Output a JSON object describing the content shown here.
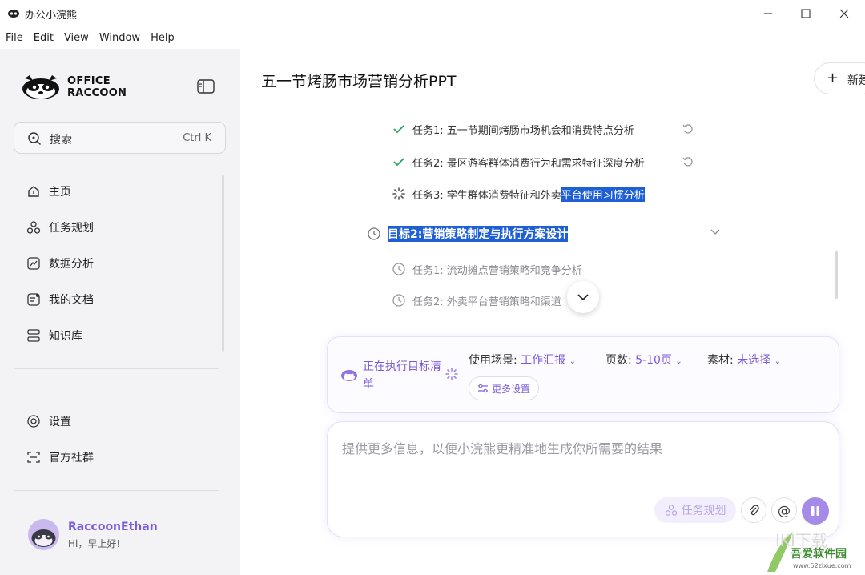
{
  "window": {
    "title": "办公小浣熊"
  },
  "menu": [
    "File",
    "Edit",
    "View",
    "Window",
    "Help"
  ],
  "sidebar": {
    "logo_line1": "OFFICE",
    "logo_line2": "RACCOON",
    "search": {
      "label": "搜索",
      "shortcut": "Ctrl K"
    },
    "nav": [
      {
        "label": "主页",
        "icon": "home-icon"
      },
      {
        "label": "任务规划",
        "icon": "task-plan-icon"
      },
      {
        "label": "数据分析",
        "icon": "data-analysis-icon"
      },
      {
        "label": "我的文档",
        "icon": "document-icon"
      },
      {
        "label": "知识库",
        "icon": "knowledge-icon"
      }
    ],
    "bottom_nav": [
      {
        "label": "设置",
        "icon": "settings-icon"
      },
      {
        "label": "官方社群",
        "icon": "community-icon"
      }
    ],
    "user": {
      "name": "RaccoonEthan",
      "greeting": "Hi，早上好!"
    }
  },
  "main": {
    "title": "五一节烤肠市场营销分析PPT",
    "new_button": "新建",
    "tasks_goal1": [
      {
        "label": "任务1: 五一节期间烤肠市场机会和消费特点分析",
        "status": "done"
      },
      {
        "label": "任务2: 景区游客群体消费行为和需求特征深度分析",
        "status": "done"
      },
      {
        "label_plain": "任务3: 学生群体消费特征和外卖",
        "label_highlight": "平台使用习惯分析",
        "status": "running"
      }
    ],
    "goal2": {
      "prefix": "目标2: ",
      "title": "营销策略制定与执行方案设计"
    },
    "tasks_goal2": [
      {
        "label": "任务1: 流动摊点营销策略和竞争分析",
        "status": "pending"
      },
      {
        "label": "任务2: 外卖平台营销策略和渠道",
        "status": "pending"
      }
    ]
  },
  "exec_panel": {
    "status": "正在执行目标清单",
    "scene_key": "使用场景:",
    "scene_val": "工作汇报",
    "pages_key": "页数:",
    "pages_val": "5-10页",
    "material_key": "素材:",
    "material_val": "未选择",
    "more_settings": "更多设置"
  },
  "input": {
    "placeholder": "提供更多信息，以便小浣熊更精准地生成你所需要的结果",
    "task_plan": "任务规划"
  },
  "watermark": {
    "site": "吾爱软件园",
    "url": "www.52zixue.com"
  },
  "colors": {
    "accent": "#7a5ad8",
    "highlight": "#1f5fd6",
    "check": "#1fa463"
  }
}
